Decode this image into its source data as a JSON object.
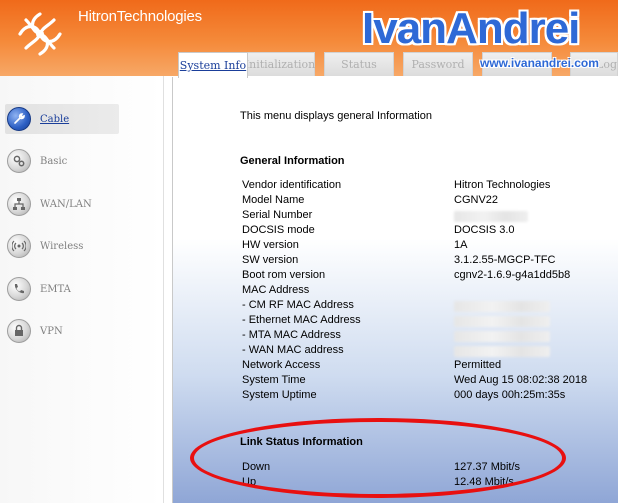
{
  "header": {
    "brand": "HitronTechnologies",
    "watermark_title": "IvanAndrei",
    "watermark_url": "www.ivanandrei.com"
  },
  "tabs": [
    {
      "label": "System Info",
      "active": true
    },
    {
      "label": "Initialization",
      "active": false
    },
    {
      "label": "Status",
      "active": false
    },
    {
      "label": "Password",
      "active": false
    },
    {
      "label": "",
      "active": false
    },
    {
      "label": "Log",
      "active": false
    }
  ],
  "sidebar": {
    "items": [
      {
        "label": "Cable",
        "icon": "wrench-icon",
        "active": true
      },
      {
        "label": "Basic",
        "icon": "gears-icon",
        "active": false
      },
      {
        "label": "WAN/LAN",
        "icon": "network-icon",
        "active": false
      },
      {
        "label": "Wireless",
        "icon": "wireless-icon",
        "active": false
      },
      {
        "label": "EMTA",
        "icon": "phone-icon",
        "active": false
      },
      {
        "label": "VPN",
        "icon": "lock-icon",
        "active": false
      }
    ]
  },
  "content": {
    "intro": "This menu displays general Information",
    "general_title": "General Information",
    "rows": [
      {
        "label": "Vendor identification",
        "value": "Hitron Technologies"
      },
      {
        "label": "Model Name",
        "value": "CGNV22"
      },
      {
        "label": "Serial Number",
        "value": "",
        "redacted": true
      },
      {
        "label": "DOCSIS mode",
        "value": "DOCSIS 3.0"
      },
      {
        "label": "HW version",
        "value": "1A"
      },
      {
        "label": "SW version",
        "value": "3.1.2.55-MGCP-TFC"
      },
      {
        "label": "Boot rom version",
        "value": "cgnv2-1.6.9-g4a1dd5b8"
      },
      {
        "label": "MAC Address",
        "value": ""
      },
      {
        "label": "- CM RF MAC Address",
        "value": "",
        "redacted": true
      },
      {
        "label": "- Ethernet MAC Address",
        "value": "",
        "redacted": true
      },
      {
        "label": "- MTA MAC Address",
        "value": "",
        "redacted": true
      },
      {
        "label": "- WAN MAC address",
        "value": "",
        "redacted": true
      },
      {
        "label": "Network Access",
        "value": "Permitted"
      },
      {
        "label": "System Time",
        "value": "Wed Aug 15 08:02:38 2018"
      },
      {
        "label": "System Uptime",
        "value": "000 days 00h:25m:35s"
      }
    ],
    "link_title": "Link Status Information",
    "link_rows": [
      {
        "label": "Down",
        "value": "127.37 Mbit/s"
      },
      {
        "label": "Up",
        "value": "12.48 Mbit/s"
      }
    ]
  },
  "colors": {
    "brand_orange": "#f06a1a",
    "link_blue": "#1a3e9a",
    "annotation_red": "#e81010"
  }
}
